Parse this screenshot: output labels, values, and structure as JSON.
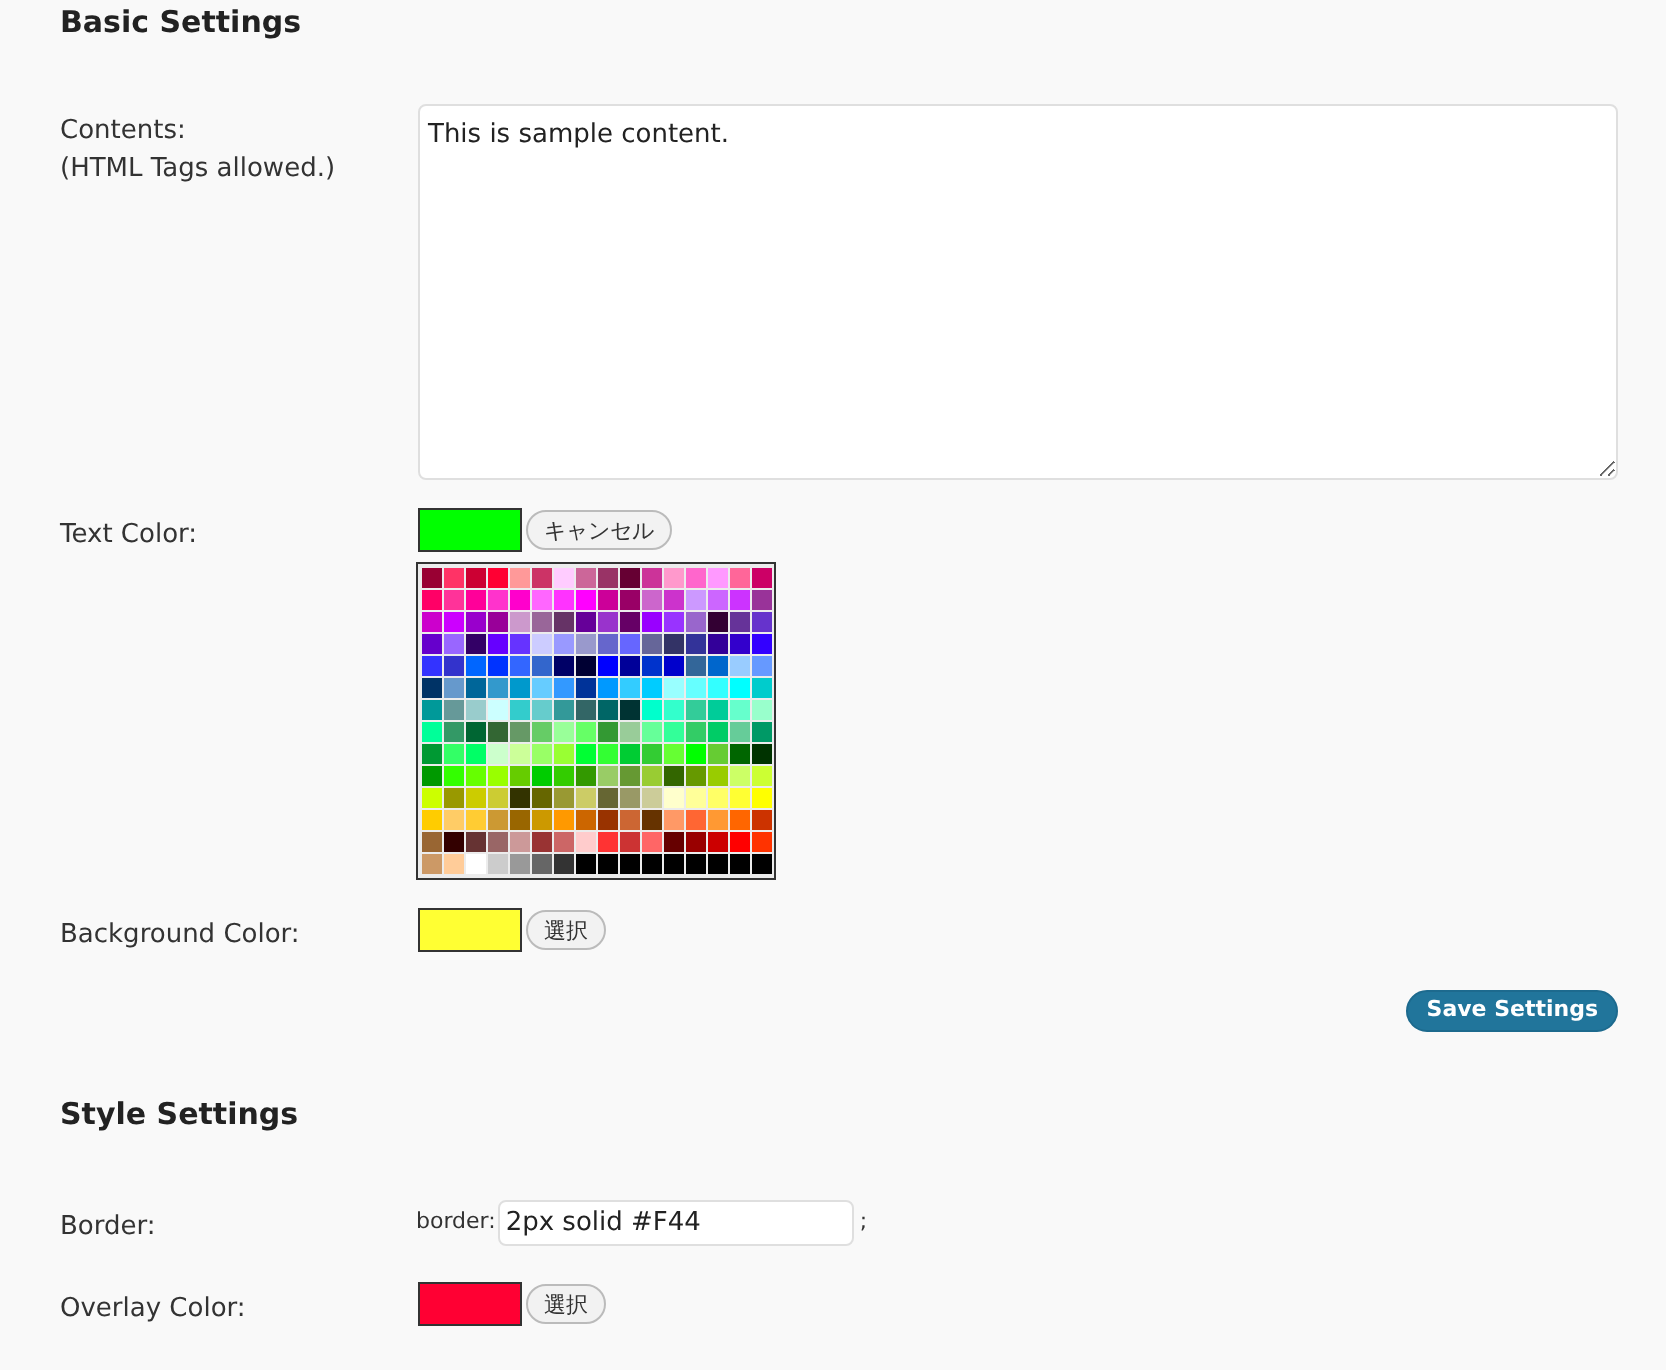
{
  "sections": [
    {
      "title": "Basic Settings",
      "rows": [
        {
          "kind": "textarea",
          "label": "Contents:",
          "hint": "(HTML Tags allowed.)",
          "value": "This is sample content."
        },
        {
          "kind": "color",
          "label": "Text Color:",
          "color": "#00ff00",
          "button": "キャンセル",
          "palette": [
            {
              "color": "#990033"
            },
            {
              "color": "#ff3366"
            },
            {
              "color": "#cc0033"
            },
            {
              "color": "#ff0033"
            },
            {
              "color": "#ff9999"
            },
            {
              "color": "#cc3366"
            },
            {
              "color": "#ffccff"
            },
            {
              "color": "#cc6699"
            },
            {
              "color": "#993366"
            },
            {
              "color": "#660033"
            },
            {
              "color": "#cc3399"
            },
            {
              "color": "#ff99cc"
            },
            {
              "color": "#ff66cc"
            },
            {
              "color": "#ff99ff"
            },
            {
              "color": "#ff6699"
            },
            {
              "color": "#cc0066"
            },
            {
              "color": "#ff0066"
            },
            {
              "color": "#ff3399"
            },
            {
              "color": "#ff0099"
            },
            {
              "color": "#ff33cc"
            },
            {
              "color": "#ff00cc"
            },
            {
              "color": "#ff66ff"
            },
            {
              "color": "#ff33ff"
            },
            {
              "color": "#ff00ff"
            },
            {
              "color": "#cc0099"
            },
            {
              "color": "#990066"
            },
            {
              "color": "#cc66cc"
            },
            {
              "color": "#cc33cc"
            },
            {
              "color": "#cc99ff"
            },
            {
              "color": "#cc66ff"
            },
            {
              "color": "#cc33ff"
            },
            {
              "color": "#993399"
            },
            {
              "color": "#cc00cc"
            },
            {
              "color": "#cc00ff"
            },
            {
              "color": "#9900cc"
            },
            {
              "color": "#990099"
            },
            {
              "color": "#cc99cc"
            },
            {
              "color": "#996699"
            },
            {
              "color": "#663366"
            },
            {
              "color": "#660099"
            },
            {
              "color": "#9933cc"
            },
            {
              "color": "#660066"
            },
            {
              "color": "#9900ff"
            },
            {
              "color": "#9933ff"
            },
            {
              "color": "#9966cc"
            },
            {
              "color": "#330033"
            },
            {
              "color": "#663399"
            },
            {
              "color": "#6633cc"
            },
            {
              "color": "#6600cc"
            },
            {
              "color": "#9966ff"
            },
            {
              "color": "#330066"
            },
            {
              "color": "#6600ff"
            },
            {
              "color": "#6633ff"
            },
            {
              "color": "#ccccff"
            },
            {
              "color": "#9999ff"
            },
            {
              "color": "#9999cc"
            },
            {
              "color": "#6666cc"
            },
            {
              "color": "#6666ff"
            },
            {
              "color": "#666699"
            },
            {
              "color": "#333366"
            },
            {
              "color": "#333399"
            },
            {
              "color": "#330099"
            },
            {
              "color": "#3300cc"
            },
            {
              "color": "#3300ff"
            },
            {
              "color": "#3333ff"
            },
            {
              "color": "#3333cc"
            },
            {
              "color": "#0066ff"
            },
            {
              "color": "#0033ff"
            },
            {
              "color": "#3366ff"
            },
            {
              "color": "#3366cc"
            },
            {
              "color": "#000066"
            },
            {
              "color": "#000033"
            },
            {
              "color": "#0000ff"
            },
            {
              "color": "#000099"
            },
            {
              "color": "#0033cc"
            },
            {
              "color": "#0000cc"
            },
            {
              "color": "#336699"
            },
            {
              "color": "#0066cc"
            },
            {
              "color": "#99ccff"
            },
            {
              "color": "#6699ff"
            },
            {
              "color": "#003366"
            },
            {
              "color": "#6699cc"
            },
            {
              "color": "#006699"
            },
            {
              "color": "#3399cc"
            },
            {
              "color": "#0099cc"
            },
            {
              "color": "#66ccff"
            },
            {
              "color": "#3399ff"
            },
            {
              "color": "#003399"
            },
            {
              "color": "#0099ff"
            },
            {
              "color": "#33ccff"
            },
            {
              "color": "#00ccff"
            },
            {
              "color": "#99ffff"
            },
            {
              "color": "#66ffff"
            },
            {
              "color": "#33ffff"
            },
            {
              "color": "#00ffff"
            },
            {
              "color": "#00cccc"
            },
            {
              "color": "#009999"
            },
            {
              "color": "#669999"
            },
            {
              "color": "#99cccc"
            },
            {
              "color": "#ccffff"
            },
            {
              "color": "#33cccc"
            },
            {
              "color": "#66cccc"
            },
            {
              "color": "#339999"
            },
            {
              "color": "#336666"
            },
            {
              "color": "#006666"
            },
            {
              "color": "#003333"
            },
            {
              "color": "#00ffcc"
            },
            {
              "color": "#33ffcc"
            },
            {
              "color": "#33cc99"
            },
            {
              "color": "#00cc99"
            },
            {
              "color": "#66ffcc"
            },
            {
              "color": "#99ffcc"
            },
            {
              "color": "#00ff99"
            },
            {
              "color": "#339966"
            },
            {
              "color": "#006633"
            },
            {
              "color": "#336633"
            },
            {
              "color": "#669966"
            },
            {
              "color": "#66cc66"
            },
            {
              "color": "#99ff99"
            },
            {
              "color": "#66ff66"
            },
            {
              "color": "#339933"
            },
            {
              "color": "#99cc99"
            },
            {
              "color": "#66ff99"
            },
            {
              "color": "#33ff99"
            },
            {
              "color": "#33cc66"
            },
            {
              "color": "#00cc66"
            },
            {
              "color": "#66cc99"
            },
            {
              "color": "#009966"
            },
            {
              "color": "#009933"
            },
            {
              "color": "#33ff66"
            },
            {
              "color": "#00ff66"
            },
            {
              "color": "#ccffcc"
            },
            {
              "color": "#ccff99"
            },
            {
              "color": "#99ff66"
            },
            {
              "color": "#99ff33"
            },
            {
              "color": "#00ff33"
            },
            {
              "color": "#33ff33"
            },
            {
              "color": "#00cc33"
            },
            {
              "color": "#33cc33"
            },
            {
              "color": "#66ff33"
            },
            {
              "color": "#00ff00"
            },
            {
              "color": "#66cc33"
            },
            {
              "color": "#006600"
            },
            {
              "color": "#003300"
            },
            {
              "color": "#009900"
            },
            {
              "color": "#33ff00"
            },
            {
              "color": "#66ff00"
            },
            {
              "color": "#99ff00"
            },
            {
              "color": "#66cc00"
            },
            {
              "color": "#00cc00"
            },
            {
              "color": "#33cc00"
            },
            {
              "color": "#339900"
            },
            {
              "color": "#99cc66"
            },
            {
              "color": "#669933"
            },
            {
              "color": "#99cc33"
            },
            {
              "color": "#336600"
            },
            {
              "color": "#669900"
            },
            {
              "color": "#99cc00"
            },
            {
              "color": "#ccff66"
            },
            {
              "color": "#ccff33"
            },
            {
              "color": "#ccff00"
            },
            {
              "color": "#999900"
            },
            {
              "color": "#cccc00"
            },
            {
              "color": "#cccc33"
            },
            {
              "color": "#333300"
            },
            {
              "color": "#666600"
            },
            {
              "color": "#999933"
            },
            {
              "color": "#cccc66"
            },
            {
              "color": "#666633"
            },
            {
              "color": "#999966"
            },
            {
              "color": "#cccc99"
            },
            {
              "color": "#ffffcc"
            },
            {
              "color": "#ffff99"
            },
            {
              "color": "#ffff66"
            },
            {
              "color": "#ffff33"
            },
            {
              "color": "#ffff00"
            },
            {
              "color": "#ffcc00"
            },
            {
              "color": "#ffcc66"
            },
            {
              "color": "#ffcc33"
            },
            {
              "color": "#cc9933"
            },
            {
              "color": "#996600"
            },
            {
              "color": "#cc9900"
            },
            {
              "color": "#ff9900"
            },
            {
              "color": "#cc6600"
            },
            {
              "color": "#993300"
            },
            {
              "color": "#cc6633"
            },
            {
              "color": "#663300"
            },
            {
              "color": "#ff9966"
            },
            {
              "color": "#ff6633"
            },
            {
              "color": "#ff9933"
            },
            {
              "color": "#ff6600"
            },
            {
              "color": "#cc3300"
            },
            {
              "color": "#996633"
            },
            {
              "color": "#330000"
            },
            {
              "color": "#663333"
            },
            {
              "color": "#996666"
            },
            {
              "color": "#cc9999"
            },
            {
              "color": "#993333"
            },
            {
              "color": "#cc6666"
            },
            {
              "color": "#ffcccc"
            },
            {
              "color": "#ff3333"
            },
            {
              "color": "#cc3333"
            },
            {
              "color": "#ff6666"
            },
            {
              "color": "#660000"
            },
            {
              "color": "#990000"
            },
            {
              "color": "#cc0000"
            },
            {
              "color": "#ff0000"
            },
            {
              "color": "#ff3300"
            },
            {
              "color": "#cc9966"
            },
            {
              "color": "#ffcc99"
            },
            {
              "color": "#ffffff"
            },
            {
              "color": "#cccccc"
            },
            {
              "color": "#999999"
            },
            {
              "color": "#666666"
            },
            {
              "color": "#333333"
            },
            {
              "color": "#000000"
            },
            {
              "color": "#000000"
            },
            {
              "color": "#000000"
            },
            {
              "color": "#000000"
            },
            {
              "color": "#000000"
            },
            {
              "color": "#000000"
            },
            {
              "color": "#000000"
            },
            {
              "color": "#000000"
            },
            {
              "color": "#000000"
            }
          ]
        },
        {
          "kind": "color",
          "label": "Background Color:",
          "color": "#ffff33",
          "button": "選択"
        }
      ],
      "save": "Save Settings"
    },
    {
      "title": "Style Settings",
      "rows": [
        {
          "kind": "text",
          "label": "Border:",
          "prefix": "border:",
          "value": "2px solid #F44",
          "suffix": ";"
        },
        {
          "kind": "color",
          "label": "Overlay Color:",
          "color": "#ff0033",
          "button": "選択"
        }
      ]
    }
  ]
}
